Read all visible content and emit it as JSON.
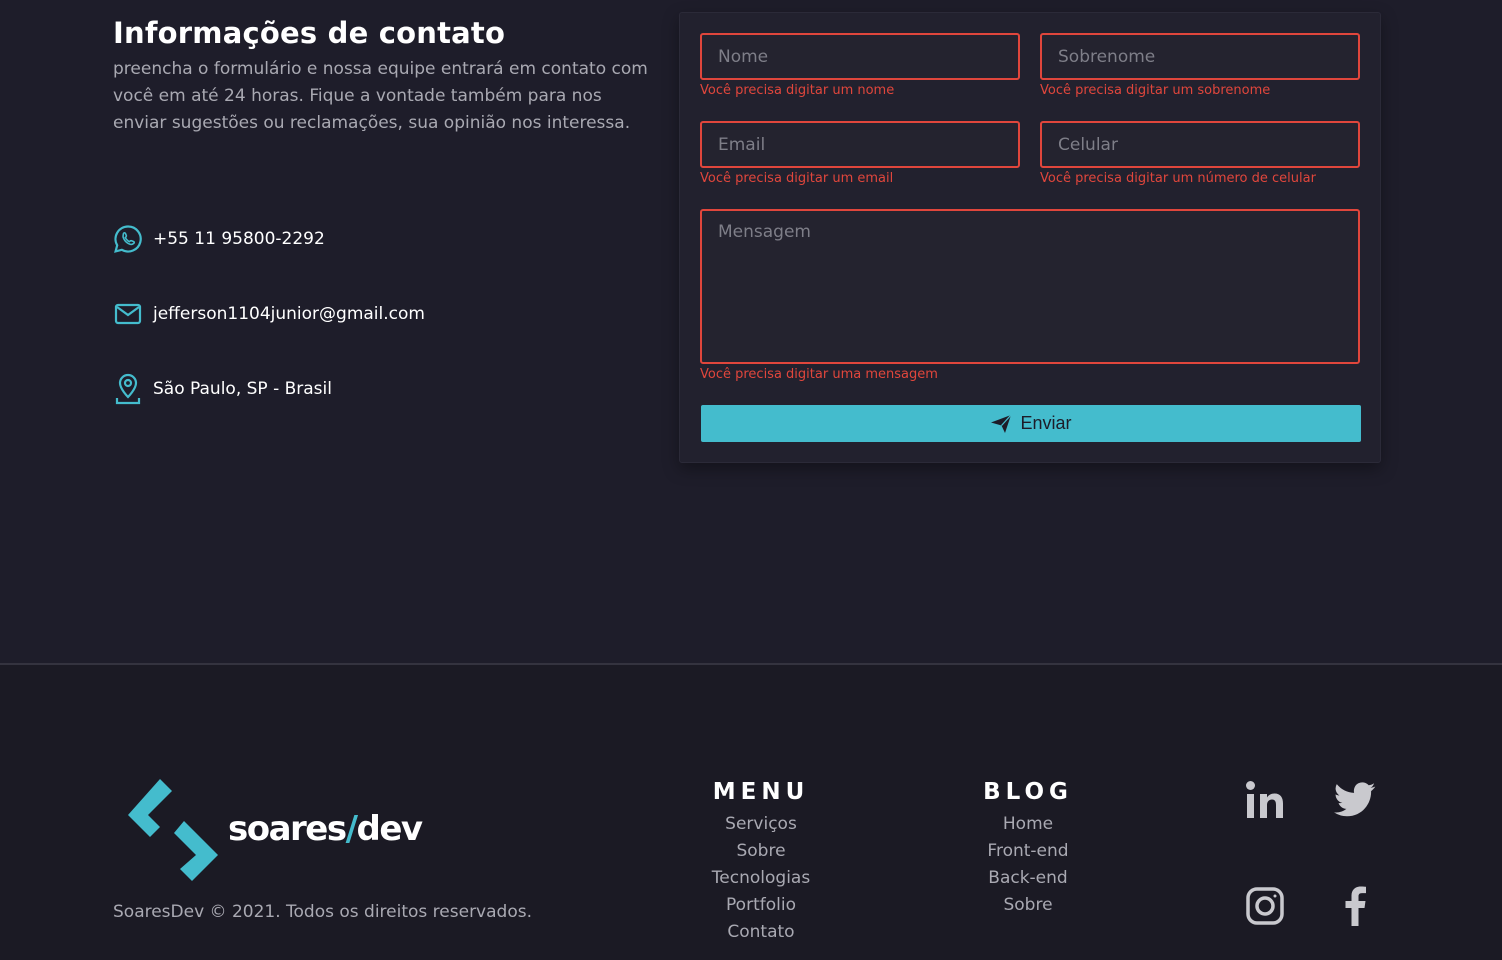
{
  "contact": {
    "title": "Informações de contato",
    "description": "preencha o formulário e nossa equipe entrará em contato com você em até 24 horas. Fique a vontade também para nos enviar sugestões ou reclamações, sua opinião nos interessa.",
    "items": [
      {
        "icon": "whatsapp-icon",
        "text": "+55 11 95800-2292"
      },
      {
        "icon": "mail-icon",
        "text": "jefferson1104junior@gmail.com"
      },
      {
        "icon": "location-pin-icon",
        "text": "São Paulo, SP - Brasil"
      }
    ]
  },
  "form": {
    "nome": {
      "placeholder": "Nome",
      "value": "",
      "error": "Você precisa digitar um nome"
    },
    "sobrenome": {
      "placeholder": "Sobrenome",
      "value": "",
      "error": "Você precisa digitar um sobrenome"
    },
    "email": {
      "placeholder": "Email",
      "value": "",
      "error": "Você precisa digitar um email"
    },
    "celular": {
      "placeholder": "Celular",
      "value": "",
      "error": "Você precisa digitar um número de celular"
    },
    "mensagem": {
      "placeholder": "Mensagem",
      "value": "",
      "error": "Você precisa digitar uma mensagem"
    },
    "submit_label": "Enviar",
    "error_color": "#e0463c",
    "accent_color": "#44bccd"
  },
  "footer": {
    "logo": {
      "text_before": "soares",
      "slash": "/",
      "text_after": "dev"
    },
    "copyright": "SoaresDev © 2021. Todos os direitos reservados.",
    "menu": {
      "title": "MENU",
      "links": [
        "Serviços",
        "Sobre",
        "Tecnologias",
        "Portfolio",
        "Contato"
      ]
    },
    "blog": {
      "title": "BLOG",
      "links": [
        "Home",
        "Front-end",
        "Back-end",
        "Sobre"
      ]
    },
    "social": [
      "linkedin-icon",
      "twitter-icon",
      "instagram-icon",
      "facebook-icon"
    ]
  }
}
